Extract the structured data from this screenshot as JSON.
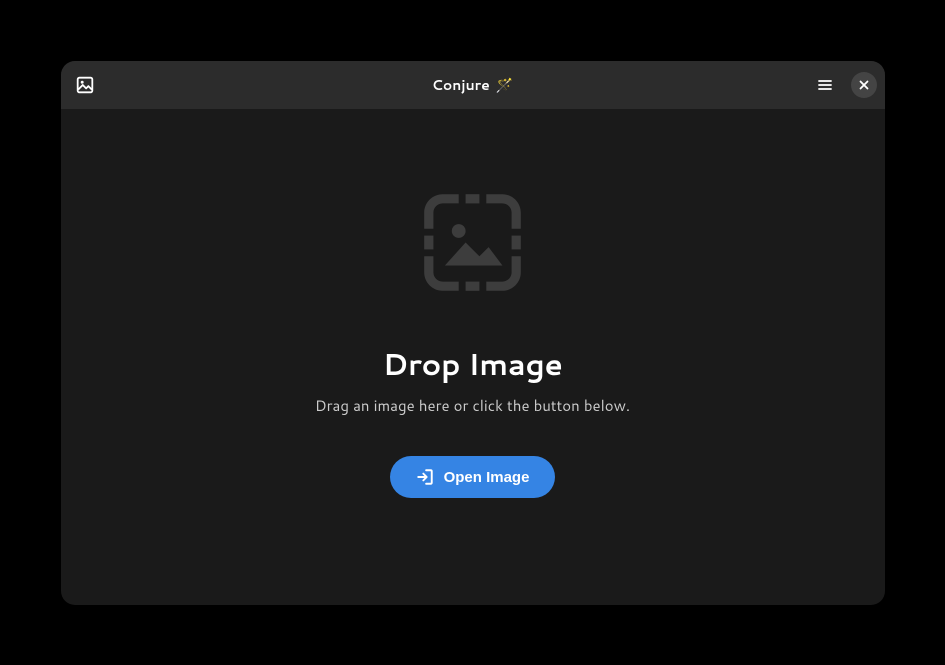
{
  "titlebar": {
    "app_name": "Conjure",
    "app_emoji": "🪄"
  },
  "content": {
    "heading": "Drop Image",
    "subtext": "Drag an image here or click the button below.",
    "open_button_label": "Open Image"
  }
}
